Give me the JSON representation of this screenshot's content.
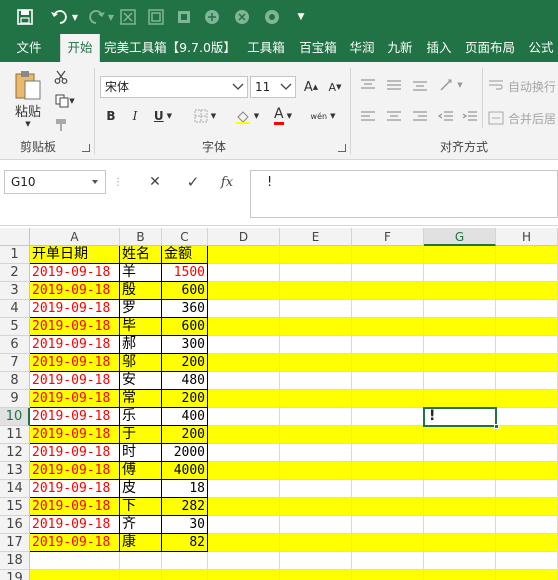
{
  "tabs": [
    "文件",
    "开始",
    "完美工具箱【9.7.0版】",
    "工具箱",
    "百宝箱",
    "华润",
    "九新",
    "插入",
    "页面布局",
    "公式"
  ],
  "active_tab": "开始",
  "ribbon": {
    "clipboard": {
      "paste": "粘贴",
      "label": "剪贴板"
    },
    "font": {
      "name": "宋体",
      "size": "11",
      "bold": "B",
      "italic": "I",
      "underline": "U",
      "font_color_letter": "A",
      "phonetic": "wén",
      "label": "字体"
    },
    "align": {
      "wrap": "自动换行",
      "merge": "合并后居",
      "label": "对齐方式"
    }
  },
  "formula_bar": {
    "name_box": "G10",
    "cancel": "✕",
    "enter": "✓",
    "fx": "fx",
    "content": "!"
  },
  "columns": [
    "A",
    "B",
    "C",
    "D",
    "E",
    "F",
    "G",
    "H"
  ],
  "selected_column": "G",
  "row_numbers": [
    "1",
    "2",
    "3",
    "4",
    "5",
    "6",
    "7",
    "8",
    "9",
    "10",
    "11",
    "12",
    "13",
    "14",
    "15",
    "16",
    "17",
    "18",
    "19"
  ],
  "selected_row": "10",
  "header_row": {
    "a": "开单日期",
    "b": "姓名",
    "c": "金额"
  },
  "rows": [
    {
      "a": "2019-09-18",
      "b": "羊",
      "c": "1500"
    },
    {
      "a": "2019-09-18",
      "b": "殷",
      "c": "600"
    },
    {
      "a": "2019-09-18",
      "b": "罗",
      "c": "360"
    },
    {
      "a": "2019-09-18",
      "b": "毕",
      "c": "600"
    },
    {
      "a": "2019-09-18",
      "b": "郝",
      "c": "300"
    },
    {
      "a": "2019-09-18",
      "b": "邬",
      "c": "200"
    },
    {
      "a": "2019-09-18",
      "b": "安",
      "c": "480"
    },
    {
      "a": "2019-09-18",
      "b": "常",
      "c": "200"
    },
    {
      "a": "2019-09-18",
      "b": "乐",
      "c": "400"
    },
    {
      "a": "2019-09-18",
      "b": "于",
      "c": "200"
    },
    {
      "a": "2019-09-18",
      "b": "时",
      "c": "2000"
    },
    {
      "a": "2019-09-18",
      "b": "傅",
      "c": "4000"
    },
    {
      "a": "2019-09-18",
      "b": "皮",
      "c": "18"
    },
    {
      "a": "2019-09-18",
      "b": "下",
      "c": "282"
    },
    {
      "a": "2019-09-18",
      "b": "齐",
      "c": "30"
    },
    {
      "a": "2019-09-18",
      "b": "康",
      "c": "82"
    }
  ],
  "active_cell_value": "!",
  "colors": {
    "excel_green": "#217346",
    "highlight": "#ffff00",
    "date_red": "#ff0000",
    "ribbon_bg": "#f3f3f3"
  }
}
